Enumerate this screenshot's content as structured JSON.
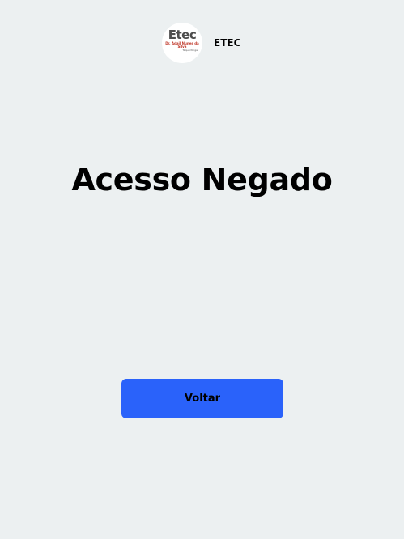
{
  "header": {
    "logo": {
      "main_text": "Etec",
      "sub_text": "Dr. Adail Nunes da Silva",
      "city_text": "Taquaritinga"
    },
    "brand": "ETEC"
  },
  "main": {
    "title": "Acesso Negado",
    "back_button_label": "Voltar"
  },
  "colors": {
    "background": "#ecf0f1",
    "button": "#2a62fa",
    "text": "#000000"
  }
}
